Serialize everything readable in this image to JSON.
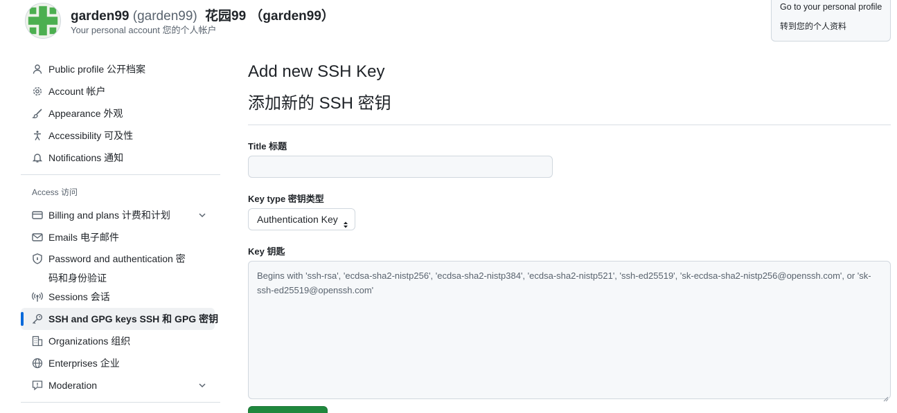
{
  "header": {
    "login": "garden99",
    "login_paren": "(garden99)",
    "display_name": "花园99 （garden99）",
    "subtitle": "Your personal account  您的个人帐户",
    "profile_button": {
      "line1": "Go to your personal profile",
      "line2": "转到您的个人资料"
    }
  },
  "sidebar": {
    "items_top": [
      {
        "label": "Public profile  公开档案",
        "icon": "person-icon"
      },
      {
        "label": "Account  帐户",
        "icon": "gear-icon"
      },
      {
        "label": "Appearance  外观",
        "icon": "paintbrush-icon"
      },
      {
        "label": "Accessibility  可及性",
        "icon": "accessibility-icon"
      },
      {
        "label": "Notifications  通知",
        "icon": "bell-icon"
      }
    ],
    "access_title": "Access  访问",
    "items_access": [
      {
        "label": "Billing and plans  计费和计划",
        "icon": "credit-card-icon",
        "expandable": true
      },
      {
        "label": "Emails  电子邮件",
        "icon": "mail-icon"
      },
      {
        "label": "Password and authentication 密码和身份验证",
        "icon": "shield-lock-icon"
      },
      {
        "label": "Sessions  会话",
        "icon": "broadcast-icon"
      },
      {
        "label": "SSH and GPG keys  SSH 和 GPG 密钥",
        "icon": "key-icon",
        "active": true
      },
      {
        "label": "Organizations  组织",
        "icon": "organization-icon"
      },
      {
        "label": "Enterprises  企业",
        "icon": "globe-icon"
      },
      {
        "label": "Moderation",
        "icon": "report-icon",
        "expandable": true
      }
    ]
  },
  "main": {
    "title_en": "Add new SSH Key",
    "title_zh": "添加新的 SSH 密钥",
    "title_field_label": "Title 标题",
    "title_value": "",
    "key_type_label": "Key type 密钥类型",
    "key_type_selected": "Authentication Key",
    "key_label": "Key 钥匙",
    "key_placeholder": "Begins with 'ssh-rsa', 'ecdsa-sha2-nistp256', 'ecdsa-sha2-nistp384', 'ecdsa-sha2-nistp521', 'ssh-ed25519', 'sk-ecdsa-sha2-nistp256@openssh.com', or 'sk-ssh-ed25519@openssh.com'"
  },
  "colors": {
    "accent": "#0969da",
    "submit_green": "#1f883d",
    "muted_text": "#59636e",
    "border": "#d0d7de"
  }
}
